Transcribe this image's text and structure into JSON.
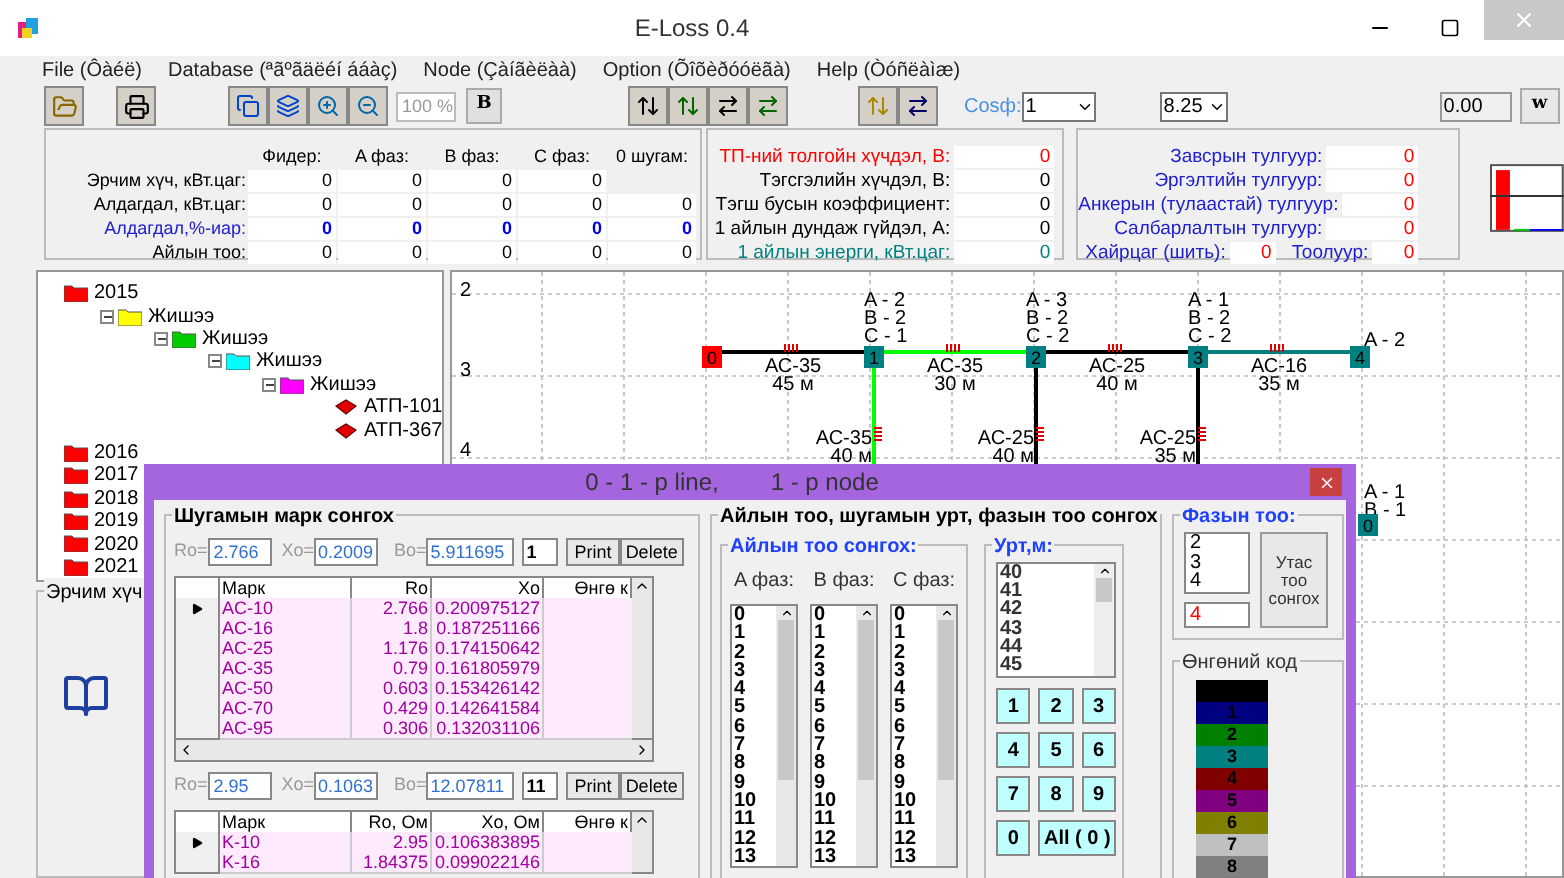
{
  "window": {
    "title": "E-Loss 0.4"
  },
  "menu": [
    "File (Ôàéë)",
    "Database (ªãºãäëéí ááàç)",
    "Node (Çàíãèëàà)",
    "Option (Õîõèðóóëãà)",
    "Help (Òóñëàìæ)"
  ],
  "toolbar": {
    "zoom": "100 %",
    "bold_button": "B",
    "cosf_label": "Cosф:",
    "cosf_value": "1",
    "voltage_value": "8.25",
    "result_value": "0.00",
    "w_button": "w"
  },
  "stats": {
    "headers": [
      "Фидер:",
      "A фаз:",
      "B фаз:",
      "C фаз:",
      "0 шугам:"
    ],
    "rows": [
      {
        "label": "Эрчим хүч, кВт.цаг:",
        "kind": "normal",
        "values": [
          "0",
          "0",
          "0",
          "0"
        ]
      },
      {
        "label": "Алдагдал, кВт.цаг:",
        "kind": "normal",
        "values": [
          "0",
          "0",
          "0",
          "0",
          "0"
        ]
      },
      {
        "label": "Алдагдал,%-иар:",
        "kind": "percent",
        "values": [
          "0",
          "0",
          "0",
          "0",
          "0"
        ]
      },
      {
        "label": "Айлын тоо:",
        "kind": "normal",
        "values": [
          "0",
          "0",
          "0",
          "0",
          "0"
        ]
      }
    ]
  },
  "voltage_panel": [
    {
      "label": "ТП-ний толгойн хүчдэл, В:",
      "value": "0",
      "color": "#ff0000"
    },
    {
      "label": "Тэгсгэлийн хүчдэл, В:",
      "value": "0",
      "color": "#000000"
    },
    {
      "label": "Тэгш бусын коэффициент:",
      "value": "0",
      "color": "#000000"
    },
    {
      "label": "1 айлын дундаж гүйдэл, А:",
      "value": "0",
      "color": "#000000"
    },
    {
      "label": "1 айлын энерги, кВт.цаг:",
      "value": "0",
      "color": "#008080"
    }
  ],
  "poles_panel": {
    "rows": [
      {
        "label": "Завсрын тулгуур:",
        "value": "0"
      },
      {
        "label": "Эргэлтийн тулгуур:",
        "value": "0"
      },
      {
        "label": "Анкерын (тулаастай) тулгуур:",
        "value": "0"
      },
      {
        "label": "Салбарлалтын тулгуур:",
        "value": "0"
      }
    ],
    "box_label": "Хайрцаг (шить):",
    "box_value": "0",
    "meter_label": "Тоолуур:",
    "meter_value": "0"
  },
  "tree": {
    "items": [
      {
        "label": "2015",
        "kind": "folder",
        "color": "#ff0000",
        "children": [
          {
            "label": "Жишээ",
            "kind": "folder",
            "color": "#ffff00",
            "children": [
              {
                "label": "Жишээ",
                "kind": "folder",
                "color": "#00cc00",
                "children": [
                  {
                    "label": "Жишээ",
                    "kind": "folder",
                    "color": "#00ffff",
                    "children": [
                      {
                        "label": "Жишээ",
                        "kind": "folder",
                        "color": "#ff00ff",
                        "children": [
                          {
                            "label": "АТП-101",
                            "kind": "device"
                          },
                          {
                            "label": "АТП-367",
                            "kind": "device"
                          }
                        ]
                      }
                    ]
                  }
                ]
              }
            ]
          }
        ]
      },
      {
        "label": "2016",
        "kind": "folder",
        "color": "#ff0000"
      },
      {
        "label": "2017",
        "kind": "folder",
        "color": "#ff0000"
      },
      {
        "label": "2018",
        "kind": "folder",
        "color": "#ff0000"
      },
      {
        "label": "2019",
        "kind": "folder",
        "color": "#ff0000"
      },
      {
        "label": "2020",
        "kind": "folder",
        "color": "#ff0000"
      },
      {
        "label": "2021",
        "kind": "folder",
        "color": "#ff0000"
      }
    ]
  },
  "energy_group": {
    "title": "Эрчим хүч"
  },
  "diagram": {
    "row_labels": [
      "2",
      "3",
      "4"
    ],
    "nodes": [
      {
        "label": "0",
        "color": "#ff0000"
      },
      {
        "label": "1",
        "color": "#008080",
        "phases": [
          "A - 2",
          "B - 2",
          "C - 1"
        ]
      },
      {
        "label": "2",
        "color": "#008080",
        "phases": [
          "A - 3",
          "B - 2",
          "C - 2"
        ]
      },
      {
        "label": "3",
        "color": "#008080",
        "phases": [
          "A - 1",
          "B - 2",
          "C - 2"
        ]
      },
      {
        "label": "4",
        "color": "#008080",
        "phases": [
          "A - 2"
        ]
      }
    ],
    "segments": [
      {
        "mark": "АС-35",
        "length": "45 м",
        "color": "#000000"
      },
      {
        "mark": "АС-35",
        "length": "30 м",
        "color": "#00ff00"
      },
      {
        "mark": "АС-25",
        "length": "40 м",
        "color": "#000000"
      },
      {
        "mark": "АС-16",
        "length": "35 м",
        "color": "#008080"
      }
    ],
    "branches": [
      {
        "mark": "АС-35",
        "length": "40 м",
        "color": "#00ff00"
      },
      {
        "mark": "АС-25",
        "length": "40 м",
        "color": "#000000"
      },
      {
        "mark": "АС-25",
        "length": "35 м",
        "color": "#000000"
      }
    ],
    "lower_node": {
      "label": "0",
      "color": "#008080",
      "phases": [
        "A - 1",
        "B - 1"
      ]
    }
  },
  "dialog": {
    "title_left": "0 - 1 - p line,",
    "title_right": "1 - p node",
    "line_group": {
      "title": "Шугамын марк сонгох",
      "grids": [
        {
          "ro_label": "Ro=",
          "ro": "2.766",
          "xo_label": "Xo=",
          "xo": "0.2009",
          "bo_label": "Bo=",
          "bo": "5.911695",
          "count": "1",
          "print": "Print",
          "delete": "Delete",
          "columns": [
            "Марк",
            "Ro",
            "Xo",
            "Өнгө к"
          ],
          "rows": [
            {
              "selected": true,
              "cells": [
                "AC-10",
                "2.766",
                "0.200975127"
              ]
            },
            {
              "selected": false,
              "cells": [
                "AC-16",
                "1.8",
                "0.187251166"
              ]
            },
            {
              "selected": false,
              "cells": [
                "AC-25",
                "1.176",
                "0.174150642"
              ]
            },
            {
              "selected": false,
              "cells": [
                "AC-35",
                "0.79",
                "0.161805979"
              ]
            },
            {
              "selected": false,
              "cells": [
                "AC-50",
                "0.603",
                "0.153426142"
              ]
            },
            {
              "selected": false,
              "cells": [
                "AC-70",
                "0.429",
                "0.142641584"
              ]
            },
            {
              "selected": false,
              "cells": [
                "AC-95",
                "0.306",
                "0.132031106"
              ]
            }
          ]
        },
        {
          "ro_label": "Ro=",
          "ro": "2.95",
          "xo_label": "Xo=",
          "xo": "0.1063",
          "bo_label": "Bo=",
          "bo": "12.07811",
          "count": "11",
          "print": "Print",
          "delete": "Delete",
          "columns": [
            "Марк",
            "Ro, Ом",
            "Xo, Ом",
            "Өнгө к"
          ],
          "rows": [
            {
              "selected": true,
              "cells": [
                "K-10",
                "2.95",
                "0.106383895"
              ]
            },
            {
              "selected": false,
              "cells": [
                "K-16",
                "1.84375",
                "0.099022146"
              ]
            }
          ]
        }
      ]
    },
    "household_group": {
      "title": "Айлын тоо, шугамын урт, фазын тоо сонгох",
      "sub_title": "Айлын тоо сонгох:",
      "phases": [
        {
          "label": "A фаз:",
          "options": [
            "0",
            "1",
            "2",
            "3",
            "4",
            "5",
            "6",
            "7",
            "8",
            "9",
            "10",
            "11",
            "12",
            "13"
          ]
        },
        {
          "label": "B фаз:",
          "options": [
            "0",
            "1",
            "2",
            "3",
            "4",
            "5",
            "6",
            "7",
            "8",
            "9",
            "10",
            "11",
            "12",
            "13"
          ]
        },
        {
          "label": "C фаз:",
          "options": [
            "0",
            "1",
            "2",
            "3",
            "4",
            "5",
            "6",
            "7",
            "8",
            "9",
            "10",
            "11",
            "12",
            "13"
          ]
        }
      ],
      "length_title": "Урт,м:",
      "lengths": [
        "40",
        "41",
        "42",
        "43",
        "44",
        "45"
      ],
      "keys": [
        "1",
        "2",
        "3",
        "4",
        "5",
        "6",
        "7",
        "8",
        "9",
        "0",
        "All ( 0 )"
      ]
    },
    "phase_count": {
      "title": "Фазын тоо:",
      "options": [
        "2",
        "3",
        "4"
      ],
      "value": "4",
      "button": "Утас тоо сонгох"
    },
    "color_code": {
      "title": "Өнгөний код",
      "swatches": [
        {
          "color": "#000000"
        },
        {
          "label": "1",
          "color": "#000080"
        },
        {
          "label": "2",
          "color": "#008000"
        },
        {
          "label": "3",
          "color": "#008080"
        },
        {
          "label": "4",
          "color": "#800000"
        },
        {
          "label": "5",
          "color": "#800080"
        },
        {
          "label": "6",
          "color": "#808000"
        },
        {
          "label": "7",
          "color": "#c0c0c0"
        },
        {
          "label": "8",
          "color": "#808080"
        }
      ]
    }
  }
}
